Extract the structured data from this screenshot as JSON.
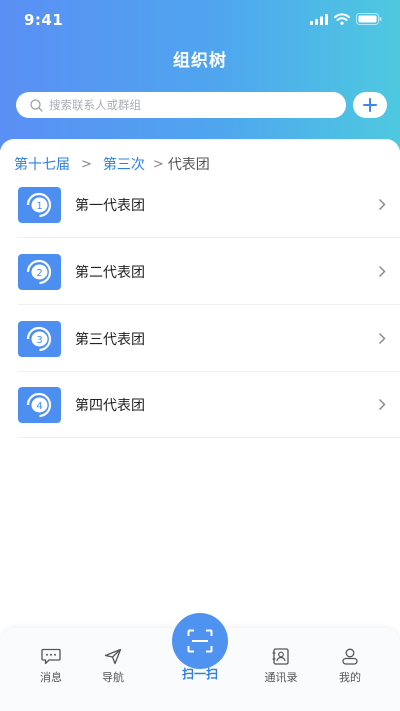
{
  "status_bar": {
    "time": "9:41"
  },
  "header": {
    "title": "组织树"
  },
  "search": {
    "placeholder": "搜索联系人或群组"
  },
  "breadcrumb": {
    "level1": "第十七届",
    "separator": ">",
    "level2": "第三次",
    "current": "代表团"
  },
  "list": {
    "items": [
      {
        "badge": "1",
        "label": "第一代表团"
      },
      {
        "badge": "2",
        "label": "第二代表团"
      },
      {
        "badge": "3",
        "label": "第三代表团"
      },
      {
        "badge": "4",
        "label": "第四代表团"
      }
    ]
  },
  "tabbar": {
    "messages": "消息",
    "navigation": "导航",
    "scan": "扫一扫",
    "contacts": "通讯录",
    "mine": "我的"
  },
  "colors": {
    "header_start": "#5a8ff5",
    "header_end": "#4ec9e0",
    "accent": "#2f80dc",
    "icon_bg": "#4d8ff0"
  },
  "icons": {
    "search": "search-icon",
    "add": "plus-icon",
    "chevron": "chevron-right-icon",
    "messages": "chat-icon",
    "navigation": "paper-plane-icon",
    "scan": "scan-icon",
    "contacts": "contact-book-icon",
    "mine": "user-icon"
  }
}
